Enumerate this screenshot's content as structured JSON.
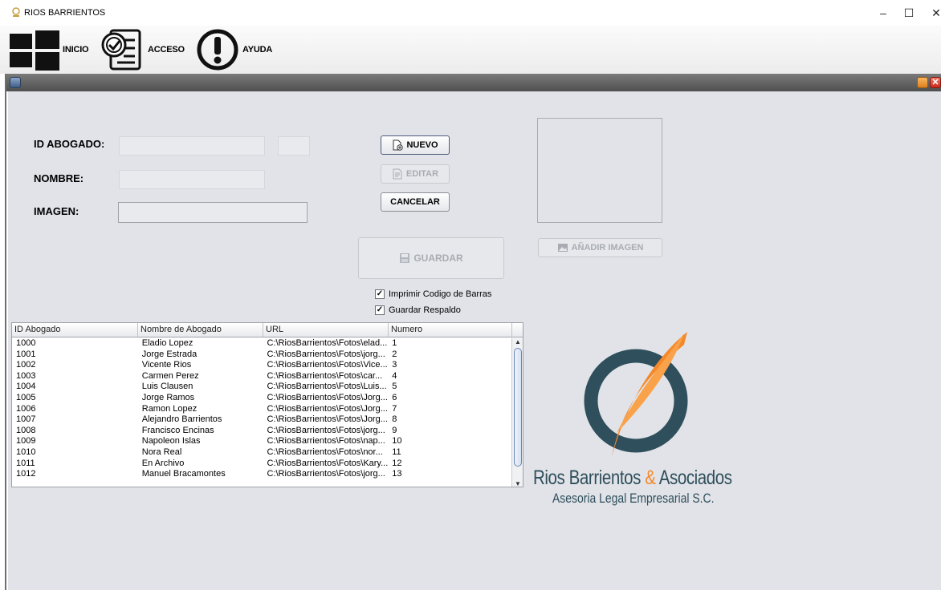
{
  "window": {
    "title": "RIOS BARRIENTOS",
    "min": "–",
    "max": "☐",
    "close": "✕"
  },
  "menu": [
    {
      "label": "INICIO",
      "icon": "windows-icon"
    },
    {
      "label": "ACCESO",
      "icon": "checklist-icon"
    },
    {
      "label": "AYUDA",
      "icon": "exclamation-icon"
    }
  ],
  "form": {
    "id_label": "ID ABOGADO:",
    "nombre_label": "NOMBRE:",
    "imagen_label": "IMAGEN:",
    "id_value": "",
    "id_extra_value": "",
    "nombre_value": "",
    "imagen_value": ""
  },
  "buttons": {
    "nuevo": "NUEVO",
    "editar": "EDITAR",
    "cancelar": "CANCELAR",
    "guardar": "GUARDAR",
    "anadir_imagen": "AÑADIR IMAGEN"
  },
  "checks": {
    "imprimir": "Imprimir Codigo de Barras",
    "respaldo": "Guardar Respaldo",
    "imprimir_checked": true,
    "respaldo_checked": true
  },
  "table": {
    "columns": [
      "ID Abogado",
      "Nombre de Abogado",
      "URL",
      "Numero"
    ],
    "rows": [
      [
        "1000",
        "Eladio Lopez",
        "C:\\RiosBarrientos\\Fotos\\elad...",
        "1"
      ],
      [
        "1001",
        "Jorge Estrada",
        "C:\\RiosBarrientos\\Fotos\\jorg...",
        "2"
      ],
      [
        "1002",
        "Vicente Rios",
        "C:\\RiosBarrientos\\Fotos\\Vice...",
        "3"
      ],
      [
        "1003",
        "Carmen Perez",
        "C:\\RiosBarrientos\\Fotos\\car...",
        "4"
      ],
      [
        "1004",
        "Luis Clausen",
        "C:\\RiosBarrientos\\Fotos\\Luis...",
        "5"
      ],
      [
        "1005",
        "Jorge Ramos",
        "C:\\RiosBarrientos\\Fotos\\Jorg...",
        "6"
      ],
      [
        "1006",
        "Ramon Lopez",
        "C:\\RiosBarrientos\\Fotos\\Jorg...",
        "7"
      ],
      [
        "1007",
        "Alejandro Barrientos",
        "C:\\RiosBarrientos\\Fotos\\Jorg...",
        "8"
      ],
      [
        "1008",
        "Francisco Encinas",
        "C:\\RiosBarrientos\\Fotos\\jorg...",
        "9"
      ],
      [
        "1009",
        "Napoleon Islas",
        "C:\\RiosBarrientos\\Fotos\\nap...",
        "10"
      ],
      [
        "1010",
        "Nora Real",
        "C:\\RiosBarrientos\\Fotos\\nor...",
        "11"
      ],
      [
        "1011",
        "En Archivo",
        "C:\\RiosBarrientos\\Fotos\\Kary...",
        "12"
      ],
      [
        "1012",
        "Manuel Bracamontes",
        "C:\\RiosBarrientos\\Fotos\\jorg...",
        "13"
      ]
    ]
  },
  "logo": {
    "name_part1": "Rios Barrientos",
    "amp": "&",
    "name_part2": "Asociados",
    "tagline": "Asesoria Legal Empresarial S.C.",
    "color_dark": "#2f4f5c",
    "color_accent": "#f5892a"
  }
}
